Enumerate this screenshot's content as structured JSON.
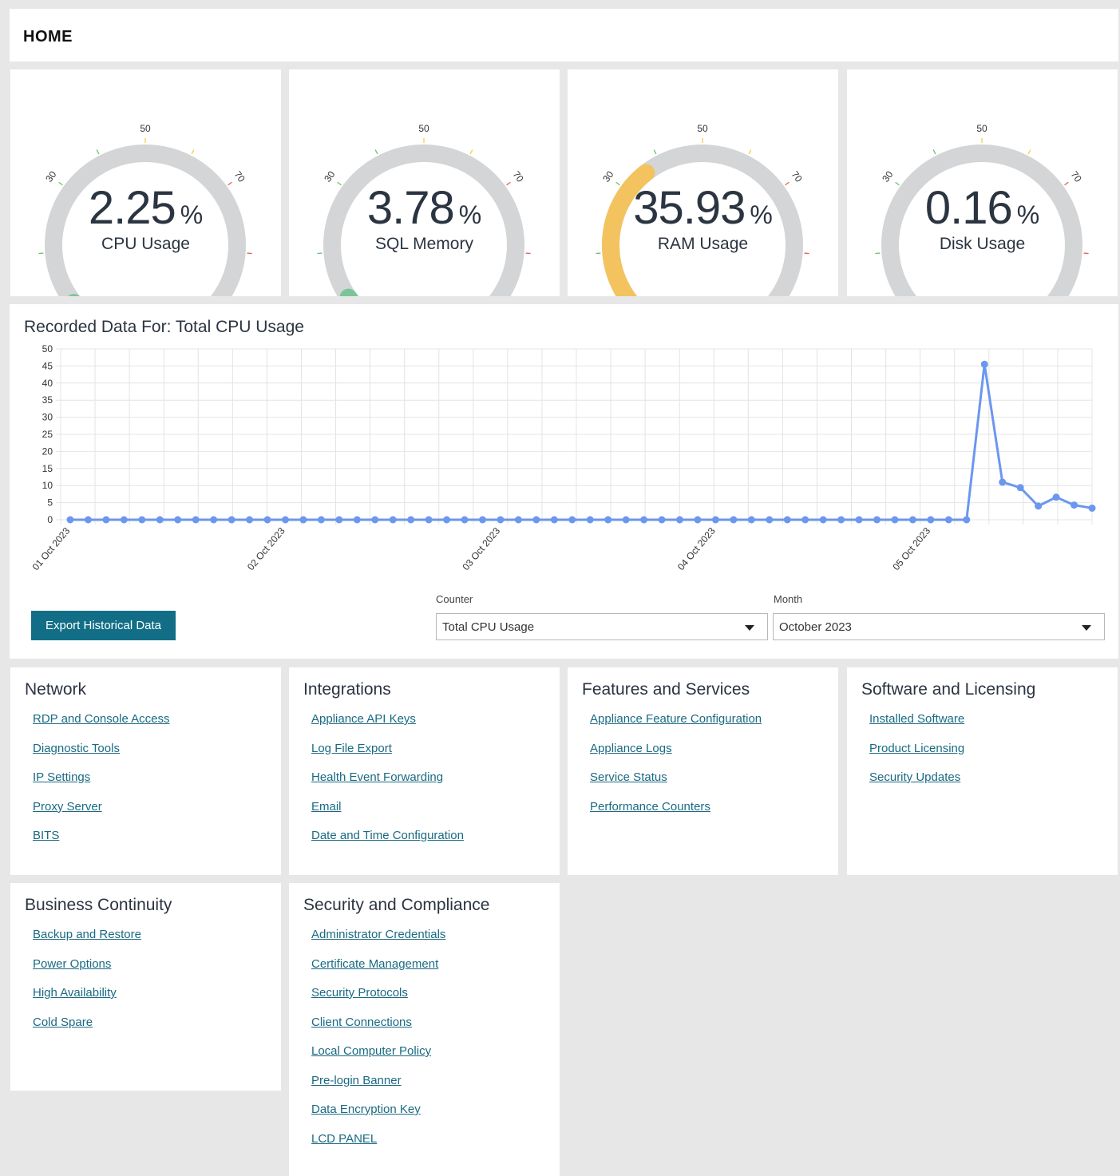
{
  "header": {
    "title": "HOME"
  },
  "gauges": [
    {
      "value": "2.25",
      "value_num": 2.25,
      "unit": "%",
      "label": "CPU Usage",
      "color": "#7cc49a",
      "style": "cap"
    },
    {
      "value": "3.78",
      "value_num": 3.78,
      "unit": "%",
      "label": "SQL Memory",
      "color": "#7cc49a",
      "style": "cap"
    },
    {
      "value": "35.93",
      "value_num": 35.93,
      "unit": "%",
      "label": "RAM Usage",
      "color": "#f3c35f",
      "style": "arc"
    },
    {
      "value": "0.16",
      "value_num": 0.16,
      "unit": "%",
      "label": "Disk Usage",
      "color": "#15967e",
      "style": "dot"
    }
  ],
  "gauge_scale": {
    "min": 0,
    "max": 100,
    "ticks": [
      "0",
      "30",
      "50",
      "70",
      "100"
    ],
    "track_color": "#d3d5d6"
  },
  "chart_title": "Recorded Data For: Total CPU Usage",
  "chart_data": {
    "type": "line",
    "title": "Recorded Data For: Total CPU Usage",
    "ylim": [
      0,
      50
    ],
    "yticks": [
      0,
      5,
      10,
      15,
      20,
      25,
      30,
      35,
      40,
      45,
      50
    ],
    "xlabels": [
      "01 Oct 2023",
      "02 Oct 2023",
      "03 Oct 2023",
      "04 Oct 2023",
      "05 Oct 2023"
    ],
    "xlabel_every": 12,
    "grid": true,
    "color": "#6b97ee",
    "series": [
      {
        "values": [
          0,
          0,
          0,
          0,
          0,
          0,
          0,
          0,
          0,
          0,
          0,
          0,
          0,
          0,
          0,
          0,
          0,
          0,
          0,
          0,
          0,
          0,
          0,
          0,
          0,
          0,
          0,
          0,
          0,
          0,
          0,
          0,
          0,
          0,
          0,
          0,
          0,
          0,
          0,
          0,
          0,
          0,
          0,
          0,
          0,
          0,
          0,
          0,
          0,
          0,
          0,
          45.5,
          11,
          9.4,
          4,
          6.6,
          4.3,
          3.4
        ]
      }
    ]
  },
  "controls": {
    "export_label": "Export Historical Data",
    "counter_label": "Counter",
    "counter_value": "Total CPU Usage",
    "month_label": "Month",
    "month_value": "October 2023"
  },
  "cards": [
    {
      "title": "Network",
      "links": [
        "RDP and Console Access",
        "Diagnostic Tools",
        "IP Settings",
        "Proxy Server",
        "BITS"
      ]
    },
    {
      "title": "Integrations",
      "links": [
        "Appliance API Keys",
        "Log File Export",
        "Health Event Forwarding",
        "Email",
        "Date and Time Configuration"
      ]
    },
    {
      "title": "Features and Services",
      "links": [
        "Appliance Feature Configuration",
        "Appliance Logs",
        "Service Status",
        "Performance Counters"
      ]
    },
    {
      "title": "Software and Licensing",
      "links": [
        "Installed Software",
        "Product Licensing",
        "Security Updates"
      ]
    },
    {
      "title": "Business Continuity",
      "links": [
        "Backup and Restore",
        "Power Options",
        "High Availability",
        "Cold Spare"
      ]
    },
    {
      "title": "Security and Compliance",
      "links": [
        "Administrator Credentials",
        "Certificate Management",
        "Security Protocols",
        "Client Connections",
        "Local Computer Policy",
        "Pre-login Banner",
        "Data Encryption Key",
        "LCD PANEL"
      ]
    }
  ]
}
